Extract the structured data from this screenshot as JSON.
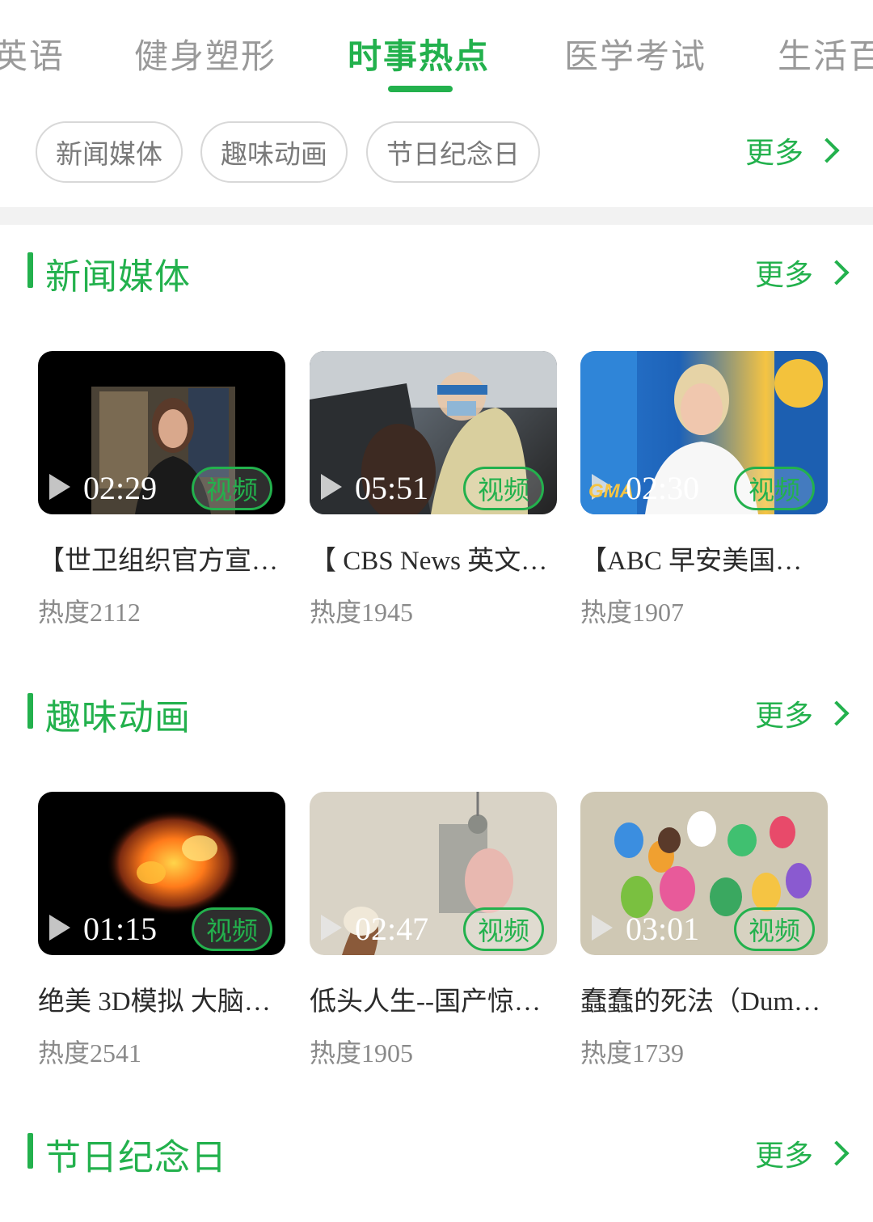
{
  "tabs": [
    "英语",
    "健身塑形",
    "时事热点",
    "医学考试",
    "生活百"
  ],
  "active_tab_index": 2,
  "filters": [
    "新闻媒体",
    "趣味动画",
    "节日纪念日"
  ],
  "more_label": "更多",
  "accent_color": "#23b14d",
  "sections": [
    {
      "title": "新闻媒体",
      "more": "更多",
      "cards": [
        {
          "duration": "02:29",
          "tag": "视频",
          "title": "【世卫组织官方宣…",
          "heat": "热度2112"
        },
        {
          "duration": "05:51",
          "tag": "视频",
          "title": "【 CBS News 英文…",
          "heat": "热度1945"
        },
        {
          "duration": "02:30",
          "tag": "视频",
          "title": "【ABC 早安美国…",
          "heat": "热度1907",
          "logo": "GMA"
        }
      ]
    },
    {
      "title": "趣味动画",
      "more": "更多",
      "cards": [
        {
          "duration": "01:15",
          "tag": "视频",
          "title": "绝美 3D模拟 大脑…",
          "heat": "热度2541"
        },
        {
          "duration": "02:47",
          "tag": "视频",
          "title": "低头人生--国产惊…",
          "heat": "热度1905"
        },
        {
          "duration": "03:01",
          "tag": "视频",
          "title": "蠢蠢的死法（Dum…",
          "heat": "热度1739"
        }
      ]
    },
    {
      "title": "节日纪念日",
      "more": "更多",
      "cards": []
    }
  ]
}
